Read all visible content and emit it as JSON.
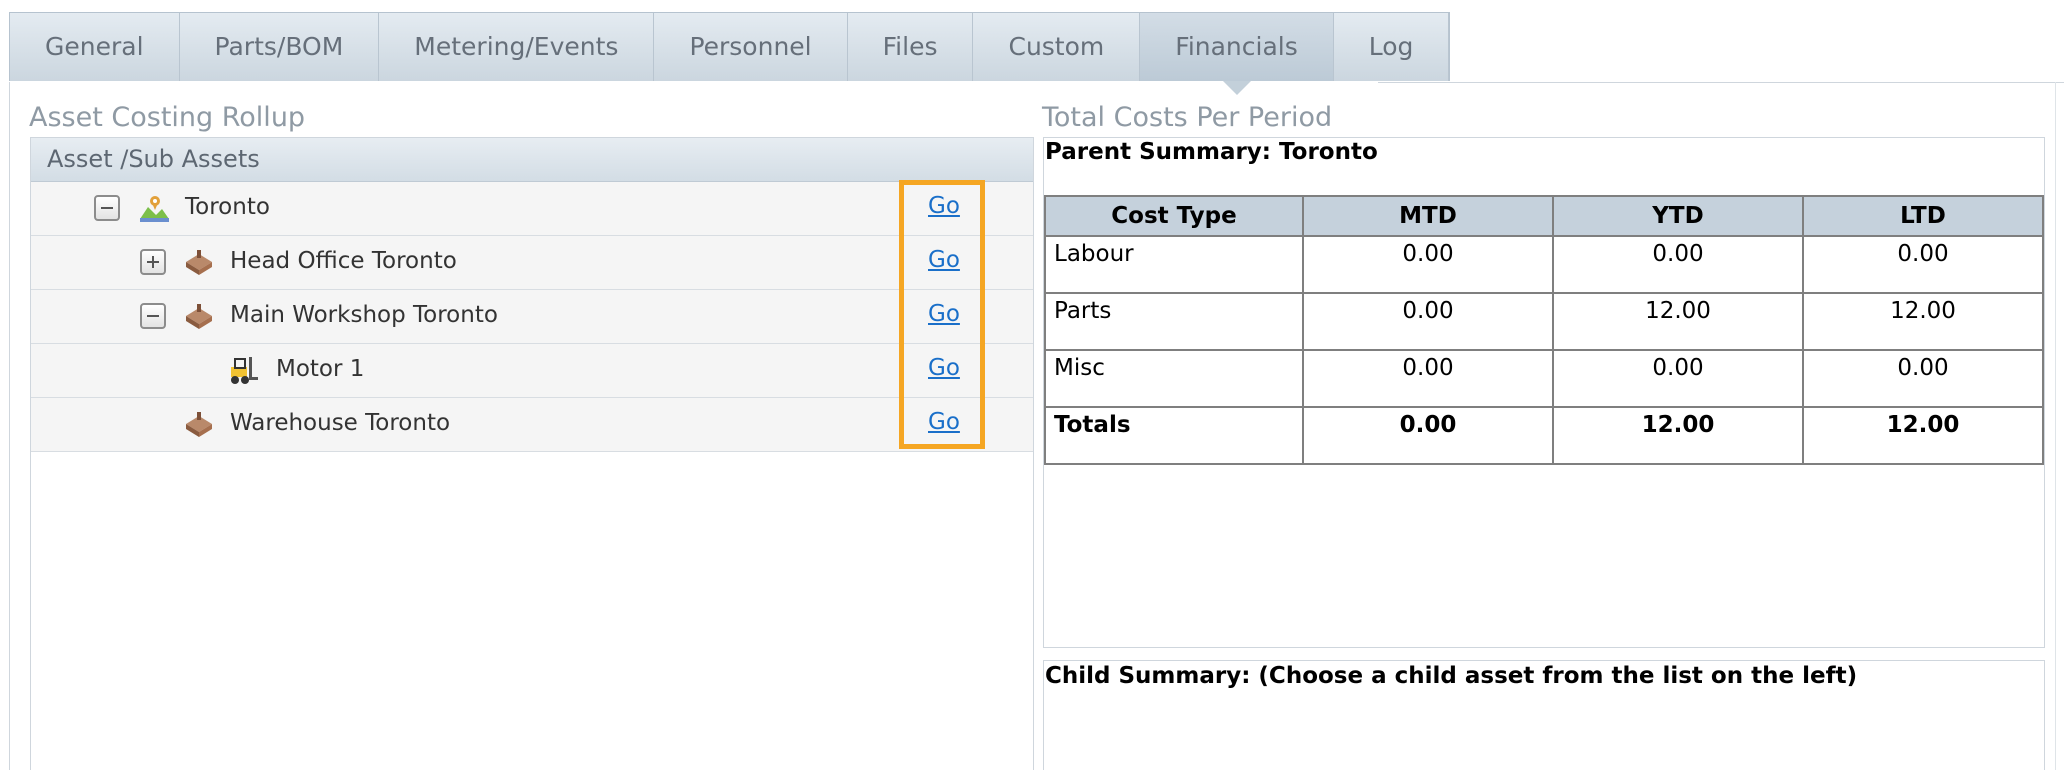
{
  "tabs": [
    {
      "label": "General",
      "active": false
    },
    {
      "label": "Parts/BOM",
      "active": false
    },
    {
      "label": "Metering/Events",
      "active": false
    },
    {
      "label": "Personnel",
      "active": false
    },
    {
      "label": "Files",
      "active": false
    },
    {
      "label": "Custom",
      "active": false
    },
    {
      "label": "Financials",
      "active": true
    },
    {
      "label": "Log",
      "active": false
    }
  ],
  "rollup": {
    "title": "Asset Costing Rollup",
    "header": "Asset /Sub Assets",
    "go_label": "Go",
    "rows": [
      {
        "label": "Toronto",
        "expander": "minus",
        "icon": "location-icon"
      },
      {
        "label": "Head Office Toronto",
        "expander": "plus",
        "icon": "building-icon"
      },
      {
        "label": "Main Workshop Toronto",
        "expander": "minus",
        "icon": "building-icon"
      },
      {
        "label": "Motor 1",
        "expander": "none",
        "icon": "forklift-icon"
      },
      {
        "label": "Warehouse Toronto",
        "expander": "none",
        "icon": "building-icon"
      }
    ]
  },
  "costs": {
    "title": "Total Costs Per Period",
    "parent_summary": "Parent Summary: Toronto",
    "columns": [
      "Cost Type",
      "MTD",
      "YTD",
      "LTD"
    ],
    "rows": [
      [
        "Labour",
        "0.00",
        "0.00",
        "0.00"
      ],
      [
        "Parts",
        "0.00",
        "12.00",
        "12.00"
      ],
      [
        "Misc",
        "0.00",
        "0.00",
        "0.00"
      ]
    ],
    "totals": [
      "Totals",
      "0.00",
      "12.00",
      "12.00"
    ],
    "child_summary": "Child Summary: (Choose a child asset from the list on the left)"
  },
  "colors": {
    "link": "#1a6fc9",
    "highlight": "#f5a623",
    "table_header": "#c5d1dc"
  }
}
